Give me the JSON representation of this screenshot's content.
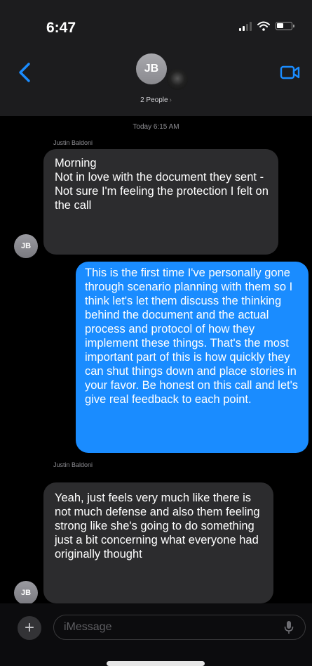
{
  "status": {
    "time": "6:47"
  },
  "header": {
    "avatar_initials": "JB",
    "people_label": "2 People",
    "people_chevron": "›",
    "icons": {
      "back": "chevron-left-icon",
      "video": "video-camera-icon"
    },
    "accent_color": "#1a8cff"
  },
  "conversation": {
    "timestamp": "Today 6:15 AM",
    "messages": [
      {
        "sender": "Justin Baldoni",
        "direction": "incoming",
        "avatar": "JB",
        "text": "Morning\nNot in love with the document they sent -\nNot sure I'm feeling the protection I felt on the call"
      },
      {
        "direction": "outgoing",
        "text": "This is the first time I've personally gone through scenario planning with them so I think let's let them discuss the thinking behind the document and the actual process and protocol of how they implement these things. That's the most important part of this is how quickly they can shut things down and place stories in your favor.  Be honest on this call and let's give real feedback to each point."
      },
      {
        "sender": "Justin Baldoni",
        "direction": "incoming",
        "avatar": "JB",
        "text": "Yeah, just feels very much like there is not much defense and also them feeling strong like she's going to do something just a bit concerning what everyone had originally thought"
      }
    ]
  },
  "composer": {
    "plus_label": "+",
    "placeholder": "iMessage",
    "icons": {
      "mic": "microphone-icon"
    }
  }
}
